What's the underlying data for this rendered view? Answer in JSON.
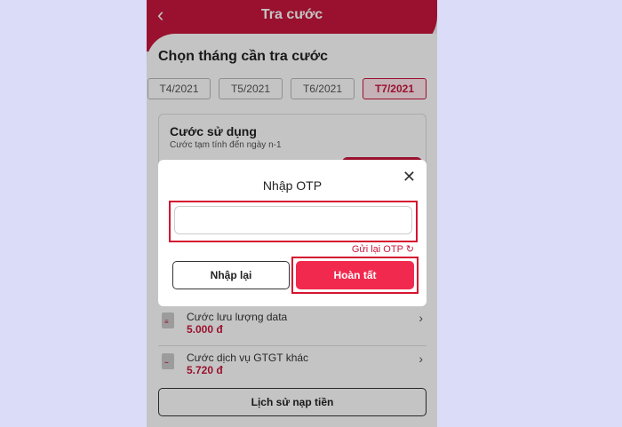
{
  "header": {
    "title": "Tra cước",
    "back_icon": "‹"
  },
  "section": {
    "title": "Chọn tháng cần tra cước"
  },
  "months": [
    {
      "label": "T4/2021",
      "active": false
    },
    {
      "label": "T5/2021",
      "active": false
    },
    {
      "label": "T6/2021",
      "active": false
    },
    {
      "label": "T7/2021",
      "active": true
    }
  ],
  "usage_card": {
    "title": "Cước sử dụng",
    "subtitle": "Cước tạm tính đến ngày n-1"
  },
  "items": [
    {
      "label": "Cước lưu lượng data",
      "value": "5.000 đ",
      "icon": "document-icon",
      "mark": "≡"
    },
    {
      "label": "Cước dịch vụ GTGT khác",
      "value": "5.720 đ",
      "icon": "chart-document-icon",
      "mark": "~"
    }
  ],
  "history_button": "Lịch sử nạp tiền",
  "modal": {
    "title": "Nhập OTP",
    "close_icon": "✕",
    "otp_value": "",
    "otp_placeholder": "",
    "resend_label": "Gửi lại OTP",
    "resend_icon": "↻",
    "retry_label": "Nhập lại",
    "done_label": "Hoàn tất"
  },
  "colors": {
    "brand": "#c8173c",
    "primary_button": "#f2294e",
    "highlight": "#d51530",
    "background": "#dadcf8"
  }
}
